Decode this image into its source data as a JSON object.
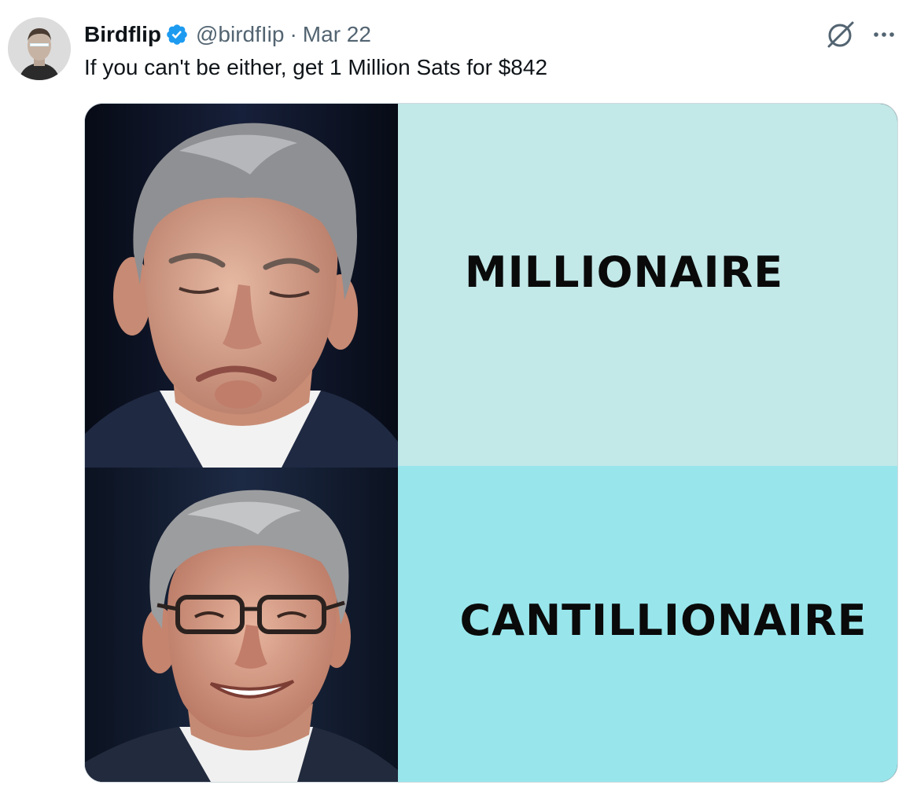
{
  "tweet": {
    "author": {
      "display_name": "Birdflip",
      "handle": "@birdfIip",
      "verified": true
    },
    "separator": "·",
    "date": "Mar 22",
    "text": "If you can't be either, get 1 Million Sats for $842",
    "media": {
      "top_label": "MILLIONAIRE",
      "bottom_label": "CANTILLIONAIRE"
    }
  },
  "icons": {
    "verified": "verified-badge-icon",
    "grok": "grok-icon",
    "more": "more-options-icon"
  },
  "colors": {
    "verified_blue": "#1d9bf0",
    "text_primary": "#0f1419",
    "text_secondary": "#536471",
    "top_label_bg": "#c2e8e8",
    "bottom_label_bg": "#98e6ec"
  }
}
